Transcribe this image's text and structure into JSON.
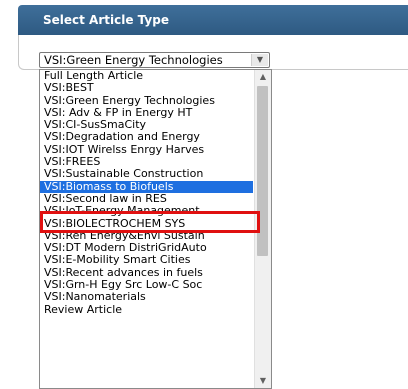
{
  "header": {
    "title": "Select Article Type"
  },
  "select": {
    "value": "VSI:Green Energy Technologies",
    "arrow_icon": "chevron-down-icon"
  },
  "dropdown": {
    "options": [
      "Full Length Article",
      "VSI:BEST",
      "VSI:Green Energy Technologies",
      "VSI: Adv & FP in Energy HT",
      "VSI:CI-SusSmaCity",
      "VSI:Degradation and Energy",
      "VSI:IOT Wirelss Enrgy Harves",
      "VSI:FREES",
      "VSI:Sustainable Construction",
      "VSI:Biomass to Biofuels",
      "VSI:Second law in RES",
      "VSI:IoT-Energy Management",
      "VSI:BIOLECTROCHEM SYS",
      "VSI:Ren Energy&Envi Sustain",
      "VSI:DT Modern DistriGridAuto",
      "VSI:E-Mobility Smart Cities",
      "VSI:Recent advances in fuels",
      "VSI:Grn-H Egy Src Low-C Soc",
      "VSI:Nanomaterials",
      "Review Article"
    ],
    "selected_index": 9,
    "highlight_color": "#e01010",
    "selected_color": "#1e6fe0"
  }
}
